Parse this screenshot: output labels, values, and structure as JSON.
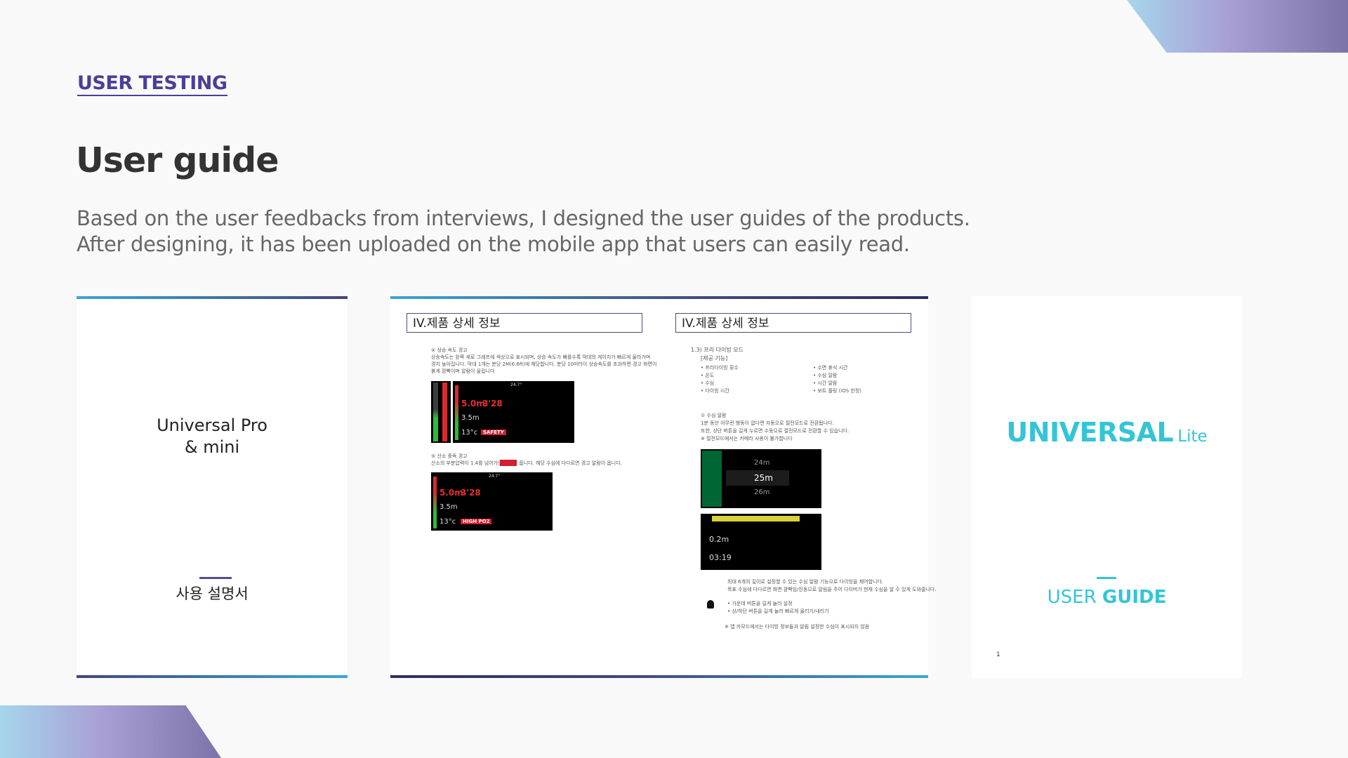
{
  "section": "USER TESTING",
  "title": "User guide",
  "description": [
    "Based on the user feedbacks from interviews, I designed the user guides of the products.",
    "After designing, it has been uploaded on the mobile app that users can easily read."
  ],
  "card1": {
    "title_line1": "Universal Pro",
    "title_line2": "& mini",
    "subtitle": "사용 설명서"
  },
  "card2": {
    "left": {
      "heading": "IV.제품 상세 정보",
      "item1_title": "④ 상승 속도 경고",
      "item1_text": [
        "상승속도는 왼쪽 세로 그래프에 색상으로 표시되며, 상승 속도가 빠를수록 막대의 게이지가 빠르게 올라가며",
        "경치 높아집니다. 막대 1개는 분당 2M(6.6ft)에 해당합니다. 분당 10미터이 상승속도를 초과하면 경고 화면이",
        "붉게 깜빡이며 알람이 울립니다"
      ],
      "screen1": {
        "depth": "5.0m",
        "time": "3'28",
        "sub": "3.5m",
        "temp": "13°c",
        "alert": "SAFETY",
        "clock": "24.7°"
      },
      "item2_title": "⑤ 산소 중독 경고",
      "item2_text": "산소의 부분압력이 1.4를 넘어가면 알람을 줍니다. 해당 수심에 다다르면 경고 알람이 옵니다.",
      "screen2": {
        "depth": "5.0m",
        "time": "3'28",
        "sub": "3.5m",
        "temp": "13°c",
        "alert": "HIGH PO2",
        "clock": "24.7°"
      }
    },
    "right": {
      "heading": "IV.제품 상세 정보",
      "sub": "1.3) 프리 다이빙 모드",
      "features_title": "[제공 기능]",
      "features_left": [
        "• 프리다이빙 횟수",
        "• 온도",
        "• 수심",
        "• 다이빙 시간"
      ],
      "features_right": [
        "• 수면 휴식 시간",
        "• 수심 알람",
        "• 시간 알람",
        "• 보트 플링 (iOS 한정)"
      ],
      "alarm_title": "① 수심 알람",
      "alarm_text": [
        "1분 동안 아무런 행동이 없다면 자동으로 절전모드로 전환됩니다.",
        "또한, 상단 버튼을 길게 누르면 수동으로 절전모드로 전환할 수 있습니다.",
        "※ 절전모드에서는 카메라 사용이 불가합니다"
      ],
      "picker_values": [
        "24m",
        "25m",
        "26m"
      ],
      "screen_depth": "0.2m",
      "screen_time": "03:19",
      "bottom_text": [
        "최대 6개의 깊이로 설정할 수 있는 수심 알람 기능으로 다이빙을 제어합니다.",
        "목표 수심에 다다르면 화면 깜빡임/진동으로 알림을 주어 다이버가 현재 수심을 알 수 있게 도와줍니다."
      ],
      "bell_lines": [
        "• 가운데 버튼을 길게 눌러 설정",
        "• 상/하단 버튼을 길게 눌러 빠르게 올리기/내리기"
      ],
      "note": "※ 앱 카모드에서는 다이빙 정보들과 알림 설정한 수심이 표시되지 않음"
    }
  },
  "card3": {
    "logo_main": "UNIVERSAL",
    "logo_sub": "Lite",
    "guide_light": "USER",
    "guide_bold": "GUIDE",
    "page_number": "1"
  },
  "colors": {
    "accent": "#4a3f9a",
    "cyan": "#33c5d6",
    "body_text": "#666666",
    "background": "#f9f9f9"
  }
}
